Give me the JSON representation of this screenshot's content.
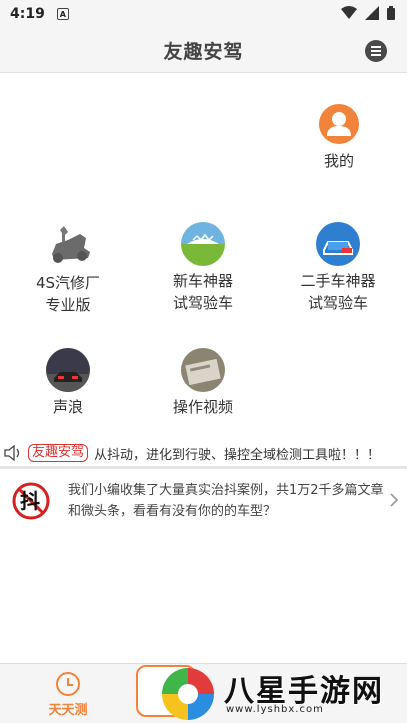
{
  "status": {
    "time": "4:19",
    "notif_letter": "A"
  },
  "header": {
    "title": "友趣安驾"
  },
  "profile": {
    "label": "我的"
  },
  "grid": [
    {
      "line1": "4S汽修厂",
      "line2": "专业版"
    },
    {
      "line1": "新车神器",
      "line2": "试驾验车"
    },
    {
      "line1": "二手车神器",
      "line2": "试驾验车"
    },
    {
      "line1": "声浪",
      "line2": ""
    },
    {
      "line1": "操作视频",
      "line2": ""
    }
  ],
  "notice": {
    "tag": "友趣安驾",
    "text": "从抖动，进化到行驶、操控全域检测工具啦！！！"
  },
  "article": {
    "icon_glyph": "抖",
    "text": "我们小编收集了大量真实治抖案例，共1万2千多篇文章和微头条，看看有没有你的的车型？"
  },
  "tabbar": {
    "tab1_label": "天天测"
  },
  "watermark": {
    "brand": "八星手游网",
    "url": "www.lyshbx.com"
  },
  "colors": {
    "accent": "#f2833a",
    "tag_red": "#d33333"
  }
}
